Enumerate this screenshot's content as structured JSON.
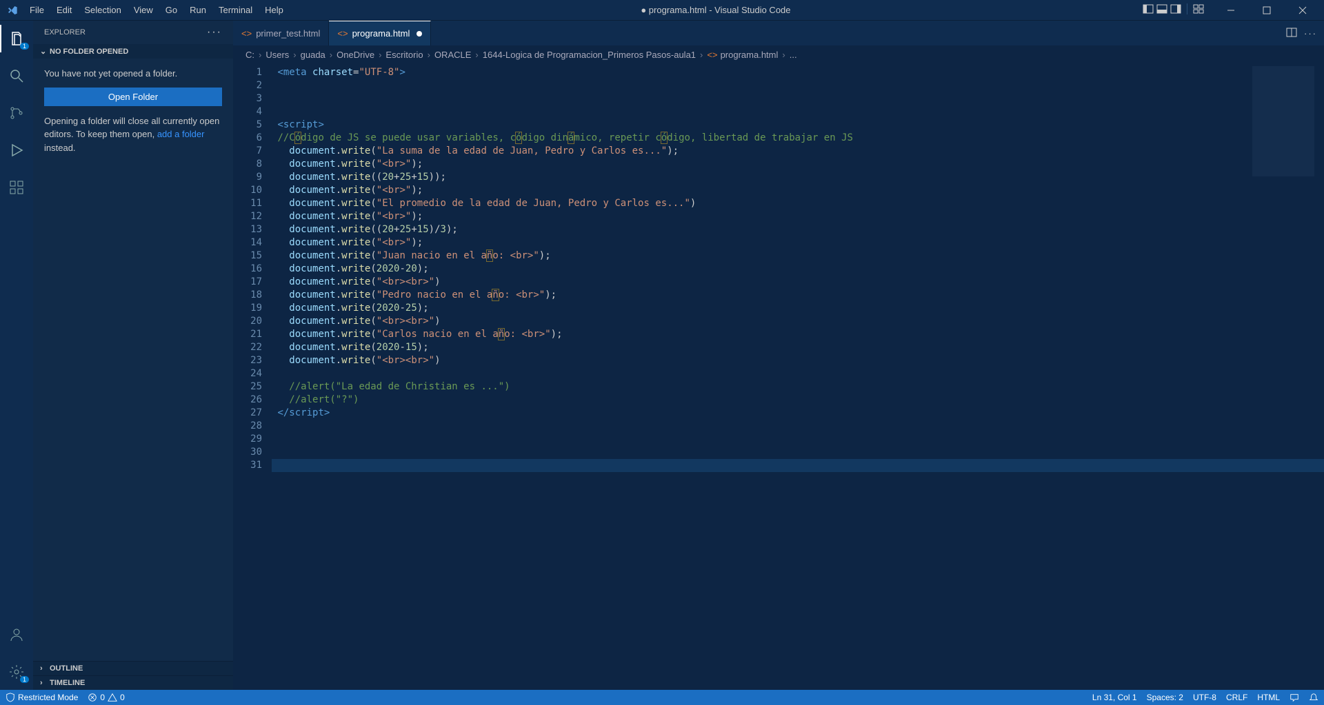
{
  "titlebar": {
    "menus": [
      "File",
      "Edit",
      "Selection",
      "View",
      "Go",
      "Run",
      "Terminal",
      "Help"
    ],
    "title": "● programa.html - Visual Studio Code"
  },
  "activitybar": {
    "explorer_badge": "1",
    "gear_badge": "1"
  },
  "sidebar": {
    "header": "EXPLORER",
    "nofolder_section": "NO FOLDER OPENED",
    "nofolder_msg1": "You have not yet opened a folder.",
    "open_folder_btn": "Open Folder",
    "nofolder_msg2a": "Opening a folder will close all currently open editors. To keep them open, ",
    "nofolder_msg2_link": "add a folder",
    "nofolder_msg2b": " instead.",
    "outline": "OUTLINE",
    "timeline": "TIMELINE"
  },
  "tabs": {
    "t1": "primer_test.html",
    "t2": "programa.html"
  },
  "breadcrumbs": {
    "parts": [
      "C:",
      "Users",
      "guada",
      "OneDrive",
      "Escritorio",
      "ORACLE",
      "1644-Logica de Programacion_Primeros Pasos-aula1"
    ],
    "file": "programa.html",
    "trailing": "..."
  },
  "code": {
    "lines_count": 31,
    "lines": [
      {
        "n": 1,
        "tokens": [
          " ",
          [
            "tag",
            "<meta"
          ],
          " ",
          [
            "attr",
            "charset"
          ],
          [
            "pun",
            "="
          ],
          [
            "str",
            "\"UTF-8\""
          ],
          [
            "tag",
            ">"
          ]
        ]
      },
      {
        "n": 2,
        "tokens": [
          ""
        ]
      },
      {
        "n": 3,
        "tokens": [
          ""
        ]
      },
      {
        "n": 4,
        "tokens": [
          ""
        ]
      },
      {
        "n": 5,
        "tokens": [
          " ",
          [
            "tag",
            "<script>"
          ]
        ]
      },
      {
        "n": 6,
        "tokens": [
          " ",
          [
            "com",
            "//C"
          ],
          [
            "hlcom",
            "ó"
          ],
          [
            "com",
            "digo de JS se puede usar variables, c"
          ],
          [
            "hlcom",
            "ó"
          ],
          [
            "com",
            "digo din"
          ],
          [
            "hlcom",
            "á"
          ],
          [
            "com",
            "mico, repetir c"
          ],
          [
            "hlcom",
            "ó"
          ],
          [
            "com",
            "digo, libertad de trabajar en JS"
          ]
        ]
      },
      {
        "n": 7,
        "tokens": [
          "   ",
          [
            "obj",
            "document"
          ],
          [
            "pun",
            "."
          ],
          [
            "fn",
            "write"
          ],
          [
            "pun",
            "("
          ],
          [
            "str",
            "\"La suma de la edad de Juan, Pedro y Carlos es...\""
          ],
          [
            "pun",
            ");"
          ]
        ]
      },
      {
        "n": 8,
        "tokens": [
          "   ",
          [
            "obj",
            "document"
          ],
          [
            "pun",
            "."
          ],
          [
            "fn",
            "write"
          ],
          [
            "pun",
            "("
          ],
          [
            "str",
            "\"<br>\""
          ],
          [
            "pun",
            ");"
          ]
        ]
      },
      {
        "n": 9,
        "tokens": [
          "   ",
          [
            "obj",
            "document"
          ],
          [
            "pun",
            "."
          ],
          [
            "fn",
            "write"
          ],
          [
            "pun",
            "(("
          ],
          [
            "num",
            "20"
          ],
          [
            "pun",
            "+"
          ],
          [
            "num",
            "25"
          ],
          [
            "pun",
            "+"
          ],
          [
            "num",
            "15"
          ],
          [
            "pun",
            "));"
          ]
        ]
      },
      {
        "n": 10,
        "tokens": [
          "   ",
          [
            "obj",
            "document"
          ],
          [
            "pun",
            "."
          ],
          [
            "fn",
            "write"
          ],
          [
            "pun",
            "("
          ],
          [
            "str",
            "\"<br>\""
          ],
          [
            "pun",
            ");"
          ]
        ]
      },
      {
        "n": 11,
        "tokens": [
          "   ",
          [
            "obj",
            "document"
          ],
          [
            "pun",
            "."
          ],
          [
            "fn",
            "write"
          ],
          [
            "pun",
            "("
          ],
          [
            "str",
            "\"El promedio de la edad de Juan, Pedro y Carlos es...\""
          ],
          [
            "pun",
            ")"
          ]
        ]
      },
      {
        "n": 12,
        "tokens": [
          "   ",
          [
            "obj",
            "document"
          ],
          [
            "pun",
            "."
          ],
          [
            "fn",
            "write"
          ],
          [
            "pun",
            "("
          ],
          [
            "str",
            "\"<br>\""
          ],
          [
            "pun",
            ");"
          ]
        ]
      },
      {
        "n": 13,
        "tokens": [
          "   ",
          [
            "obj",
            "document"
          ],
          [
            "pun",
            "."
          ],
          [
            "fn",
            "write"
          ],
          [
            "pun",
            "(("
          ],
          [
            "num",
            "20"
          ],
          [
            "pun",
            "+"
          ],
          [
            "num",
            "25"
          ],
          [
            "pun",
            "+"
          ],
          [
            "num",
            "15"
          ],
          [
            "pun",
            ")/"
          ],
          [
            "num",
            "3"
          ],
          [
            "pun",
            ");"
          ]
        ]
      },
      {
        "n": 14,
        "tokens": [
          "   ",
          [
            "obj",
            "document"
          ],
          [
            "pun",
            "."
          ],
          [
            "fn",
            "write"
          ],
          [
            "pun",
            "("
          ],
          [
            "str",
            "\"<br>\""
          ],
          [
            "pun",
            ");"
          ]
        ]
      },
      {
        "n": 15,
        "tokens": [
          "   ",
          [
            "obj",
            "document"
          ],
          [
            "pun",
            "."
          ],
          [
            "fn",
            "write"
          ],
          [
            "pun",
            "("
          ],
          [
            "str",
            "\"Juan nacio en el a"
          ],
          [
            "hlstr",
            "ñ"
          ],
          [
            "str",
            "o: <br>\""
          ],
          [
            "pun",
            ");"
          ]
        ]
      },
      {
        "n": 16,
        "tokens": [
          "   ",
          [
            "obj",
            "document"
          ],
          [
            "pun",
            "."
          ],
          [
            "fn",
            "write"
          ],
          [
            "pun",
            "("
          ],
          [
            "num",
            "2020"
          ],
          [
            "pun",
            "-"
          ],
          [
            "num",
            "20"
          ],
          [
            "pun",
            ");"
          ]
        ]
      },
      {
        "n": 17,
        "tokens": [
          "   ",
          [
            "obj",
            "document"
          ],
          [
            "pun",
            "."
          ],
          [
            "fn",
            "write"
          ],
          [
            "pun",
            "("
          ],
          [
            "str",
            "\"<br><br>\""
          ],
          [
            "pun",
            ")"
          ]
        ]
      },
      {
        "n": 18,
        "tokens": [
          "   ",
          [
            "obj",
            "document"
          ],
          [
            "pun",
            "."
          ],
          [
            "fn",
            "write"
          ],
          [
            "pun",
            "("
          ],
          [
            "str",
            "\"Pedro nacio en el a"
          ],
          [
            "hlstr",
            "ñ"
          ],
          [
            "str",
            "o: <br>\""
          ],
          [
            "pun",
            ");"
          ]
        ]
      },
      {
        "n": 19,
        "tokens": [
          "   ",
          [
            "obj",
            "document"
          ],
          [
            "pun",
            "."
          ],
          [
            "fn",
            "write"
          ],
          [
            "pun",
            "("
          ],
          [
            "num",
            "2020"
          ],
          [
            "pun",
            "-"
          ],
          [
            "num",
            "25"
          ],
          [
            "pun",
            ");"
          ]
        ]
      },
      {
        "n": 20,
        "tokens": [
          "   ",
          [
            "obj",
            "document"
          ],
          [
            "pun",
            "."
          ],
          [
            "fn",
            "write"
          ],
          [
            "pun",
            "("
          ],
          [
            "str",
            "\"<br><br>\""
          ],
          [
            "pun",
            ")"
          ]
        ]
      },
      {
        "n": 21,
        "tokens": [
          "   ",
          [
            "obj",
            "document"
          ],
          [
            "pun",
            "."
          ],
          [
            "fn",
            "write"
          ],
          [
            "pun",
            "("
          ],
          [
            "str",
            "\"Carlos nacio en el a"
          ],
          [
            "hlstr",
            "ñ"
          ],
          [
            "str",
            "o: <br>\""
          ],
          [
            "pun",
            ");"
          ]
        ]
      },
      {
        "n": 22,
        "tokens": [
          "   ",
          [
            "obj",
            "document"
          ],
          [
            "pun",
            "."
          ],
          [
            "fn",
            "write"
          ],
          [
            "pun",
            "("
          ],
          [
            "num",
            "2020"
          ],
          [
            "pun",
            "-"
          ],
          [
            "num",
            "15"
          ],
          [
            "pun",
            ");"
          ]
        ]
      },
      {
        "n": 23,
        "tokens": [
          "   ",
          [
            "obj",
            "document"
          ],
          [
            "pun",
            "."
          ],
          [
            "fn",
            "write"
          ],
          [
            "pun",
            "("
          ],
          [
            "str",
            "\"<br><br>\""
          ],
          [
            "pun",
            ")"
          ]
        ]
      },
      {
        "n": 24,
        "tokens": [
          ""
        ]
      },
      {
        "n": 25,
        "tokens": [
          "   ",
          [
            "com",
            "//alert(\"La edad de Christian es ...\")"
          ]
        ]
      },
      {
        "n": 26,
        "tokens": [
          "   ",
          [
            "com",
            "//alert(\"?\")"
          ]
        ]
      },
      {
        "n": 27,
        "tokens": [
          " ",
          [
            "tag",
            "</script>"
          ]
        ]
      },
      {
        "n": 28,
        "tokens": [
          ""
        ]
      },
      {
        "n": 29,
        "tokens": [
          ""
        ]
      },
      {
        "n": 30,
        "tokens": [
          ""
        ]
      },
      {
        "n": 31,
        "tokens": [
          ""
        ],
        "cursor": true
      }
    ]
  },
  "statusbar": {
    "restricted": "Restricted Mode",
    "errors": "0",
    "warnings": "0",
    "lncol": "Ln 31, Col 1",
    "spaces": "Spaces: 2",
    "enc": "UTF-8",
    "eol": "CRLF",
    "lang": "HTML"
  }
}
